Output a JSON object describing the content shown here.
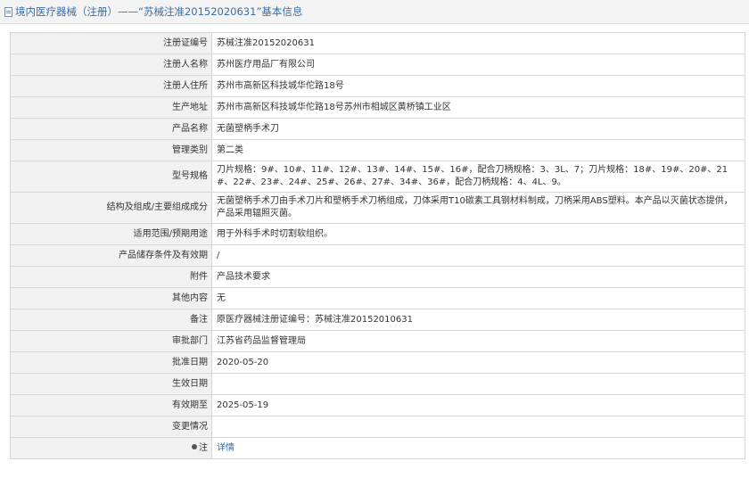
{
  "header": {
    "title": "境内医疗器械（注册）——“苏械注准20152020631”基本信息",
    "icon": "document-icon"
  },
  "rows": [
    {
      "label": "注册证编号",
      "value": "苏械注准20152020631"
    },
    {
      "label": "注册人名称",
      "value": "苏州医疗用品厂有限公司"
    },
    {
      "label": "注册人住所",
      "value": "苏州市高新区科技城华佗路18号"
    },
    {
      "label": "生产地址",
      "value": "苏州市高新区科技城华佗路18号苏州市相城区黄桥镇工业区"
    },
    {
      "label": "产品名称",
      "value": "无菌塑柄手术刀"
    },
    {
      "label": "管理类别",
      "value": "第二类"
    },
    {
      "label": "型号规格",
      "value": "刀片规格：9#、10#、11#、12#、13#、14#、15#、16#，配合刀柄规格：3、3L、7；刀片规格：18#、19#、20#、21#、22#、23#、24#、25#、26#、27#、34#、36#，配合刀柄规格：4、4L、9。"
    },
    {
      "label": "结构及组成/主要组成成分",
      "value": "无菌塑柄手术刀由手术刀片和塑柄手术刀柄组成，刀体采用T10碳素工具钢材料制成，刀柄采用ABS塑料。本产品以灭菌状态提供，产品采用辐照灭菌。"
    },
    {
      "label": "适用范围/预期用途",
      "value": "用于外科手术时切割软组织。"
    },
    {
      "label": "产品储存条件及有效期",
      "value": "/"
    },
    {
      "label": "附件",
      "value": "产品技术要求"
    },
    {
      "label": "其他内容",
      "value": "无"
    },
    {
      "label": "备注",
      "value": "原医疗器械注册证编号：苏械注准20152010631"
    },
    {
      "label": "审批部门",
      "value": "江苏省药品监督管理局"
    },
    {
      "label": "批准日期",
      "value": "2020-05-20"
    },
    {
      "label": "生效日期",
      "value": ""
    },
    {
      "label": "有效期至",
      "value": "2025-05-19"
    },
    {
      "label": "变更情况",
      "value": ""
    }
  ],
  "footer": {
    "label": "注",
    "link": "详情",
    "icon": "pin-icon"
  },
  "colors": {
    "title_text": "#3a6ea8",
    "label_bg": "#f1f1f1",
    "border": "#d6d6d6",
    "link": "#2b6cb0"
  }
}
